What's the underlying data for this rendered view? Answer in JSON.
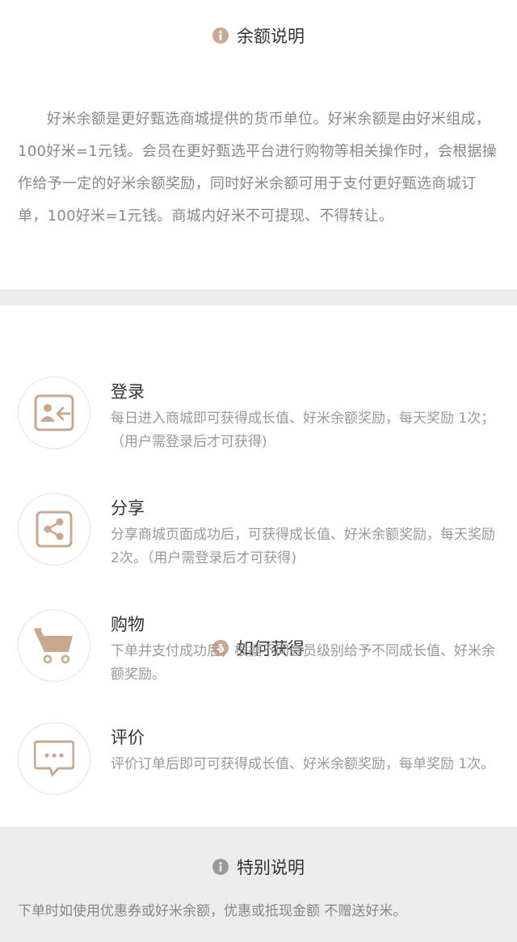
{
  "balance": {
    "title": "余额说明",
    "icon": "info-icon",
    "text": "好米余额是更好甄选商城提供的货币单位。好米余额是由好米组成，100好米=1元钱。会员在更好甄选平台进行购物等相关操作时，会根据操作给予一定的好米余额奖励，同时好米余额可用于支付更好甄选商城订单，100好米=1元钱。商城内好米不可提现、不得转让。"
  },
  "earn": {
    "title": "如何获得",
    "icon": "money-bag-icon",
    "items": [
      {
        "title": "登录",
        "icon": "login-icon",
        "desc": "每日进入商城即可获得成长值、好米余额奖励，每天奖励 1次；（用户需登录后才可获得)"
      },
      {
        "title": "分享",
        "icon": "share-icon",
        "desc": "分享商城页面成功后，可获得成长值、好米余额奖励，每天奖励2次。（用户需登录后才可获得)"
      },
      {
        "title": "购物",
        "icon": "cart-icon",
        "desc": "下单并支付成功后，根据不同会员级别给予不同成长值、好米余额奖励。"
      },
      {
        "title": "评价",
        "icon": "comment-icon",
        "desc": "评价订单后即可可获得成长值、好米余额奖励，每单奖励 1次。"
      }
    ]
  },
  "special": {
    "title": "特别说明",
    "icon": "info-icon",
    "text": "下单时如使用优惠券或好米余额，优惠或抵现金额 不赠送好米。"
  },
  "colors": {
    "accent": "#c8a98f",
    "gray_icon": "#9a9a9a",
    "text_dark": "#333333",
    "text_light": "#999999",
    "divider": "#ececec"
  }
}
